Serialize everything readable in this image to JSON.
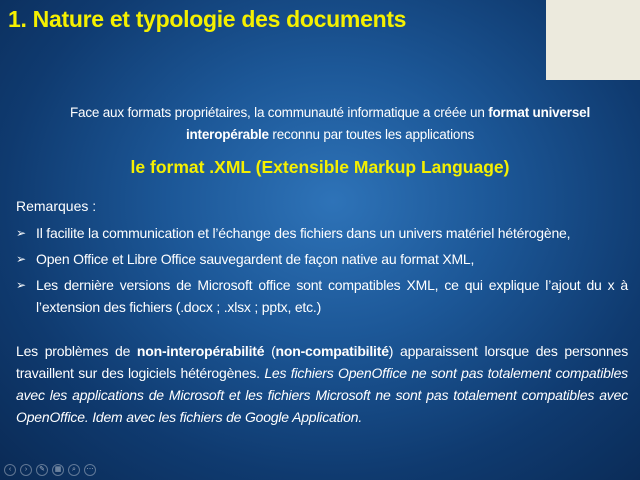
{
  "title": "1. Nature et typologie des documents",
  "intro": {
    "part1": "Face aux formats propriétaires, la communauté informatique a créée un ",
    "bold1": "format universel interopérable",
    "part2": " reconnu par toutes les applications"
  },
  "xml_heading": "le format .XML (Extensible Markup Language)",
  "remarks_title": "Remarques :",
  "bullets": [
    "Il facilite la communication et l’échange des fichiers dans un univers matériel hétérogène,",
    "Open Office et Libre Office sauvegardent de façon native au format XML,",
    "Les dernière versions de Microsoft office sont compatibles XML, ce qui explique l’ajout du x à l’extension des fichiers (.docx ; .xlsx ; pptx, etc.)"
  ],
  "paragraph": {
    "t1": "Les problèmes de ",
    "b1": "non-interopérabilité",
    "t2": " (",
    "b2": "non-compatibilité",
    "t3": ") apparaissent lorsque des personnes travaillent sur des logiciels hétérogènes. ",
    "italic": "Les fichiers OpenOffice ne sont pas totalement compatibles avec les applications de Microsoft et les fichiers Microsoft ne sont pas totalement compatibles avec OpenOffice. Idem avec les fichiers de Google Application."
  },
  "colors": {
    "accent": "#f5f000",
    "background": "#1c5797",
    "corner": "#eceadd"
  },
  "nav_icons": [
    "prev-icon",
    "next-icon",
    "pen-icon",
    "slides-icon",
    "zoom-icon",
    "more-icon"
  ]
}
